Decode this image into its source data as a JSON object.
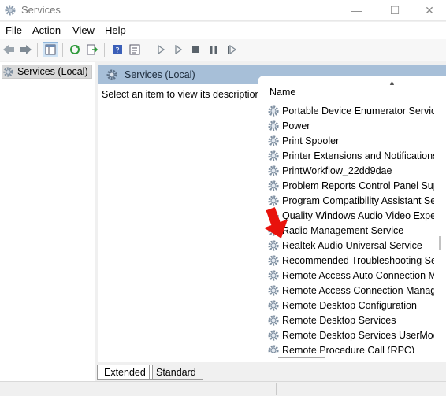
{
  "window": {
    "title": "Services",
    "minimize_glyph": "—",
    "maximize_glyph": "☐",
    "close_glyph": "✕"
  },
  "menu": [
    "File",
    "Action",
    "View",
    "Help"
  ],
  "toolbar": {
    "icons": [
      "back-icon",
      "forward-icon",
      "show-hide-console-tree-icon",
      "refresh-icon",
      "export-list-icon",
      "help-icon",
      "properties-icon",
      "start-service-icon",
      "start-alt-icon",
      "stop-service-icon",
      "pause-service-icon",
      "resume-service-icon"
    ]
  },
  "tree": {
    "selected_item": "Services (Local)"
  },
  "right_pane": {
    "header": "Services (Local)",
    "description": "Select an item to view its description.",
    "column_header": "Name"
  },
  "services": [
    "Portable Device Enumerator Service",
    "Power",
    "Print Spooler",
    "Printer Extensions and Notifications",
    "PrintWorkflow_22dd9dae",
    "Problem Reports Control Panel Supp",
    "Program Compatibility Assistant Serv",
    "Quality Windows Audio Video Experi",
    "Radio Management Service",
    "Realtek Audio Universal Service",
    "Recommended Troubleshooting Serv",
    "Remote Access Auto Connection Ma",
    "Remote Access Connection Manager",
    "Remote Desktop Configuration",
    "Remote Desktop Services",
    "Remote Desktop Services UserMode",
    "Remote Procedure Call (RPC)"
  ],
  "tabs": {
    "extended": "Extended",
    "standard": "Standard"
  },
  "colors": {
    "header_bg": "#a7bfd8",
    "arrow": "#e8120c"
  }
}
